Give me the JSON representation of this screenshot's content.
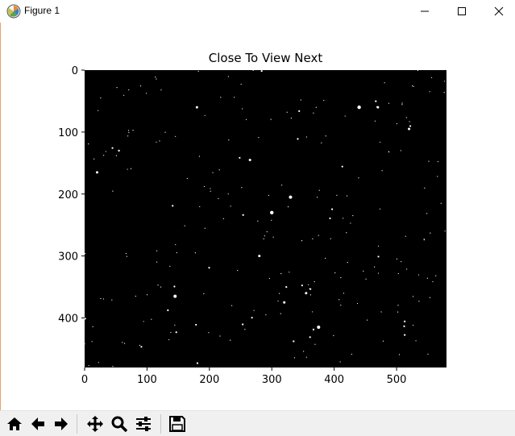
{
  "window": {
    "title": "Figure 1"
  },
  "figure": {
    "title": "Close To View Next",
    "image": {
      "width": 580,
      "height": 480,
      "background": "#000000",
      "point_color": "#ffffff"
    },
    "x_ticks": [
      "0",
      "100",
      "200",
      "300",
      "400",
      "500"
    ],
    "y_ticks": [
      "0",
      "100",
      "200",
      "300",
      "400"
    ]
  },
  "toolbar": {
    "buttons": [
      {
        "name": "home-button",
        "icon": "home-icon"
      },
      {
        "name": "back-button",
        "icon": "arrow-left-icon"
      },
      {
        "name": "forward-button",
        "icon": "arrow-right-icon"
      },
      {
        "name": "pan-button",
        "icon": "move-icon"
      },
      {
        "name": "zoom-button",
        "icon": "magnifier-icon"
      },
      {
        "name": "configure-subplots-button",
        "icon": "sliders-icon"
      },
      {
        "name": "save-button",
        "icon": "floppy-disk-icon"
      }
    ]
  }
}
